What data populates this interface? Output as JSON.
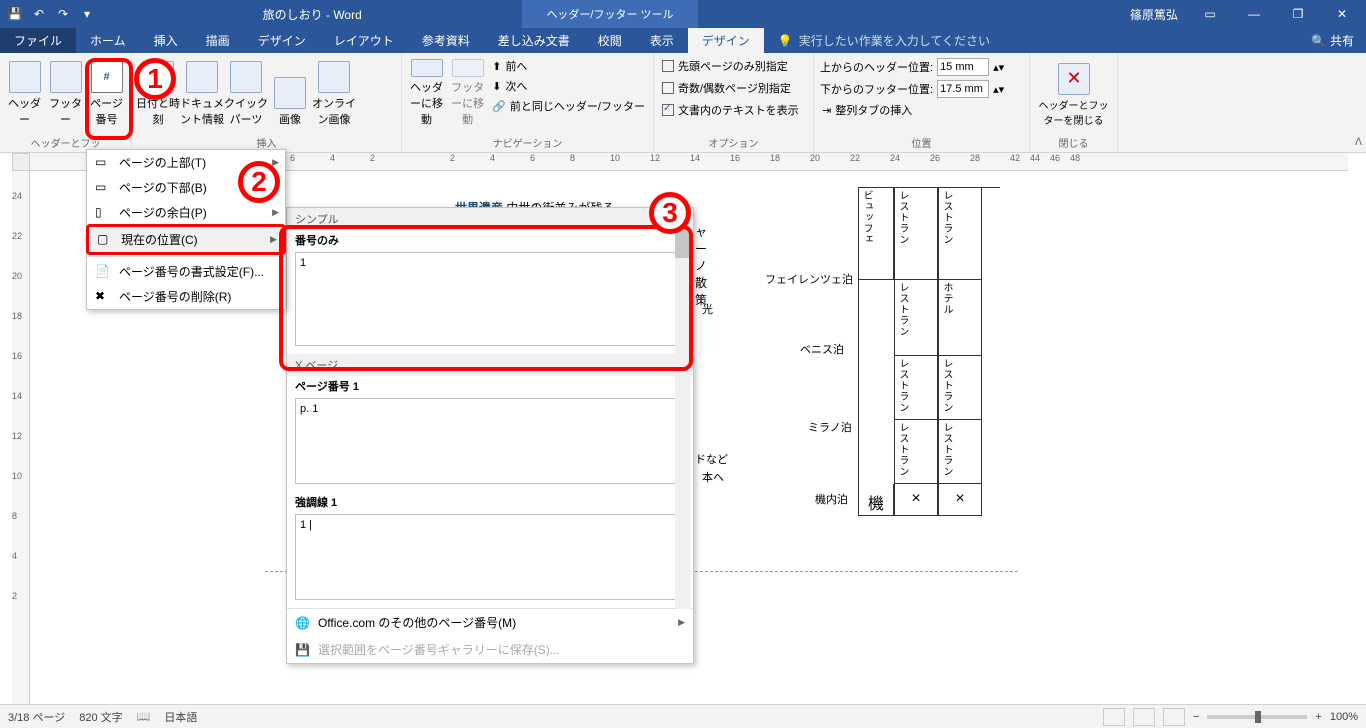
{
  "title": "旅のしおり - Word",
  "tooltab": "ヘッダー/フッター ツール",
  "user": "篠原篤弘",
  "tabs": {
    "file": "ファイル",
    "home": "ホーム",
    "insert": "挿入",
    "draw": "描画",
    "design": "デザイン",
    "layout": "レイアウト",
    "ref": "参考資料",
    "mail": "差し込み文書",
    "review": "校閲",
    "view": "表示",
    "design2": "デザイン"
  },
  "tell": "実行したい作業を入力してください",
  "share": "共有",
  "ribbon": {
    "grp_hf": "ヘッダーとフッ",
    "header": "ヘッダー",
    "footer": "フッター",
    "page_no": "ページ番号",
    "date": "日付と時刻",
    "docinfo": "ドキュメント情報",
    "quick": "クイック パーツ",
    "image": "画像",
    "online": "オンライン画像",
    "nav": "ナビゲーション",
    "goto_h": "ヘッダーに移動",
    "goto_f": "フッターに移動",
    "prev": "前へ",
    "next": "次へ",
    "same": "前と同じヘッダー/フッター",
    "opt": "オプション",
    "first": "先頭ページのみ別指定",
    "odd": "奇数/偶数ページ別指定",
    "showtext": "文書内のテキストを表示",
    "pos": "位置",
    "fromtop": "上からのヘッダー位置:",
    "frombot": "下からのフッター位置:",
    "top_v": "15 mm",
    "bot_v": "17.5 mm",
    "align": "整列タブの挿入",
    "closegrp": "閉じる",
    "close": "ヘッダーとフッターを閉じる"
  },
  "dd": {
    "top": "ページの上部(T)",
    "bottom": "ページの下部(B)",
    "margin": "ページの余白(P)",
    "current": "現在の位置(C)",
    "format": "ページ番号の書式設定(F)...",
    "remove": "ページ番号の削除(R)"
  },
  "gallery": {
    "hdr": "シンプル",
    "opt1": "番号のみ",
    "preview1": "1",
    "sec2": "X ベージ",
    "opt2": "ページ番号 1",
    "preview2": "p. 1",
    "opt3": "強調線 1",
    "preview3": "1 |",
    "more": "Office.com のその他のページ番号(M)",
    "save": "選択範囲をページ番号ギャラリーに保存(S)..."
  },
  "doc": {
    "h1pre": "世界遺産",
    "h1": "中世の街並みが残る",
    "h1suf": "光",
    "l2": "ャーノ散策",
    "l3": "フェイレンツェ泊",
    "l4": "光",
    "l5": "ベニス泊",
    "l6": "ミラノ泊",
    "l7": "ドなど",
    "l8": "本へ",
    "l9": "機内泊",
    "l10": "機",
    "c1": "ビュッフェ",
    "c2": "レストラン",
    "c3": "レストラン",
    "c4": "レストラン",
    "c5": "ホテル",
    "c6": "レストラン",
    "c7": "レストラン",
    "c8": "レストラン",
    "c9": "レストラン",
    "x": "×"
  },
  "status": {
    "page": "3/18 ページ",
    "words": "820 文字",
    "lang": "日本語",
    "zoom": "100%"
  }
}
